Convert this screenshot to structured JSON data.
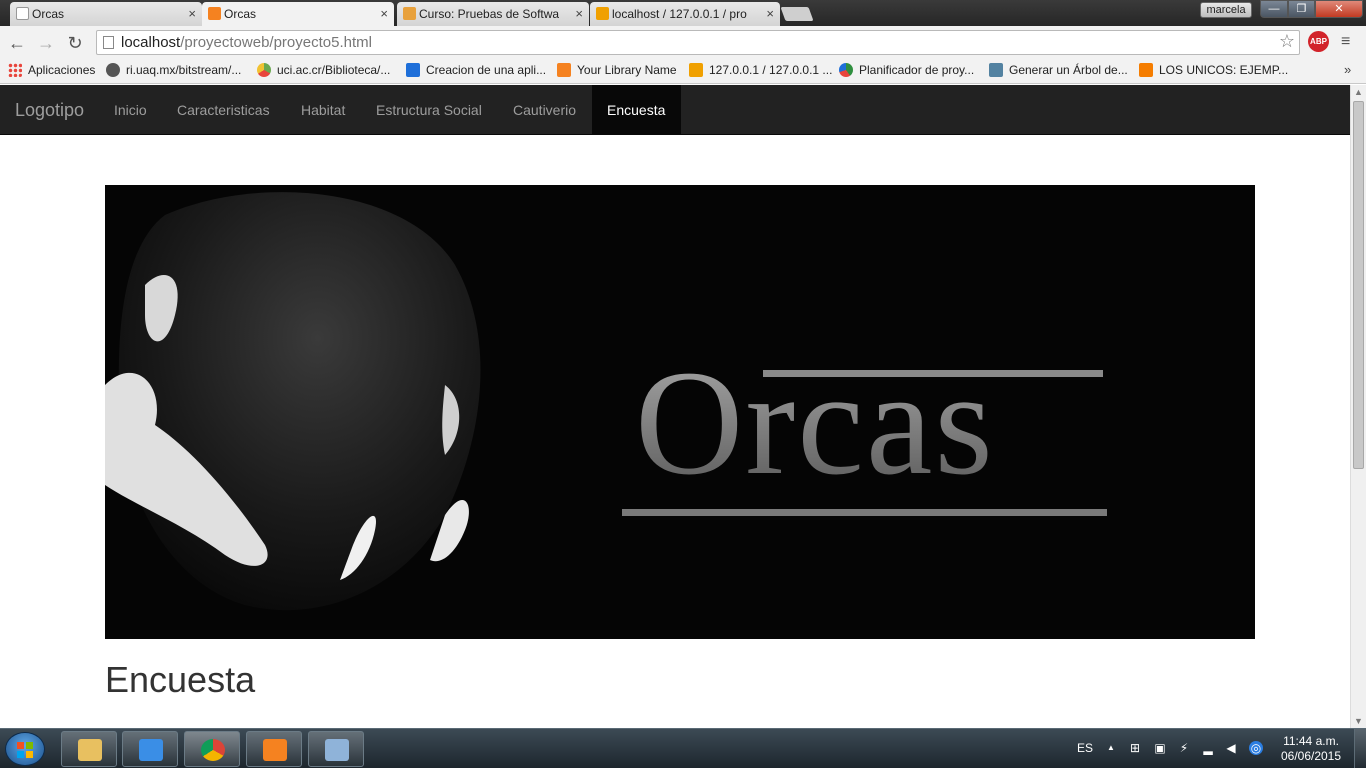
{
  "window": {
    "user_label": "marcela",
    "minimize_symbol": "—",
    "maximize_symbol": "❐",
    "close_symbol": "✕"
  },
  "tabs": [
    {
      "label": "Orcas",
      "icon": "page-icon",
      "close": "×"
    },
    {
      "label": "Orcas",
      "icon": "xampp-icon",
      "close": "×"
    },
    {
      "label": "Curso: Pruebas de Softwa",
      "icon": "moodle-icon",
      "close": "×"
    },
    {
      "label": "localhost / 127.0.0.1 / pro",
      "icon": "phpmyadmin-icon",
      "close": "×"
    }
  ],
  "toolbar": {
    "back_symbol": "←",
    "forward_symbol": "→",
    "reload_symbol": "↻",
    "url_host": "localhost",
    "url_path": "/proyectoweb/proyecto5.html",
    "star_symbol": "☆",
    "abp_label": "ABP",
    "menu_symbol": "≡"
  },
  "bookmarks": [
    {
      "label": "Aplicaciones",
      "icon": "apps-grid-icon",
      "color": "#e8453c"
    },
    {
      "label": "ri.uaq.mx/bitstream/...",
      "icon": "dspace-icon",
      "color": "#333333"
    },
    {
      "label": "uci.ac.cr/Biblioteca/...",
      "icon": "chrome-like-icon",
      "color": "#6aa84f"
    },
    {
      "label": "Creacion de una apli...",
      "icon": "bookmark-blue-icon",
      "color": "#1e6fd9"
    },
    {
      "label": "Your Library Name",
      "icon": "xampp-icon",
      "color": "#f58220"
    },
    {
      "label": "127.0.0.1 / 127.0.0.1 ...",
      "icon": "phpmyadmin-icon",
      "color": "#f0a000"
    },
    {
      "label": "Planificador de proy...",
      "icon": "pie-icon",
      "color": "#2f8f3f"
    },
    {
      "label": "Generar un Árbol de...",
      "icon": "java-icon",
      "color": "#5382a1"
    },
    {
      "label": "LOS UNICOS: EJEMP...",
      "icon": "blogger-icon",
      "color": "#f57d00"
    }
  ],
  "bookmarks_overflow": "»",
  "site": {
    "brand": "Logotipo",
    "nav": [
      {
        "label": "Inicio",
        "active": false
      },
      {
        "label": "Caracteristicas",
        "active": false
      },
      {
        "label": "Habitat",
        "active": false
      },
      {
        "label": "Estructura Social",
        "active": false
      },
      {
        "label": "Cautiverio",
        "active": false
      },
      {
        "label": "Encuesta",
        "active": true
      }
    ],
    "hero_title": "Orcas",
    "page_heading": "Encuesta"
  },
  "taskbar": {
    "apps": [
      {
        "name": "file-explorer",
        "icon": "folder-icon",
        "color": "#e8c060"
      },
      {
        "name": "media-player",
        "icon": "media-player-icon",
        "color": "#3a8ee6"
      },
      {
        "name": "chrome",
        "icon": "chrome-icon",
        "color": "#db4437",
        "active": true
      },
      {
        "name": "xampp",
        "icon": "xampp-icon",
        "color": "#f58220"
      },
      {
        "name": "paint",
        "icon": "paint-icon",
        "color": "#8fb3d9"
      }
    ],
    "language": "ES",
    "tray_expand": "▲",
    "time": "11:44 a.m.",
    "date": "06/06/2015"
  },
  "colors": {
    "nav_bg": "#222222",
    "nav_active_bg": "#080808",
    "nav_text": "#9d9d9d",
    "hero_bg": "#050505"
  }
}
